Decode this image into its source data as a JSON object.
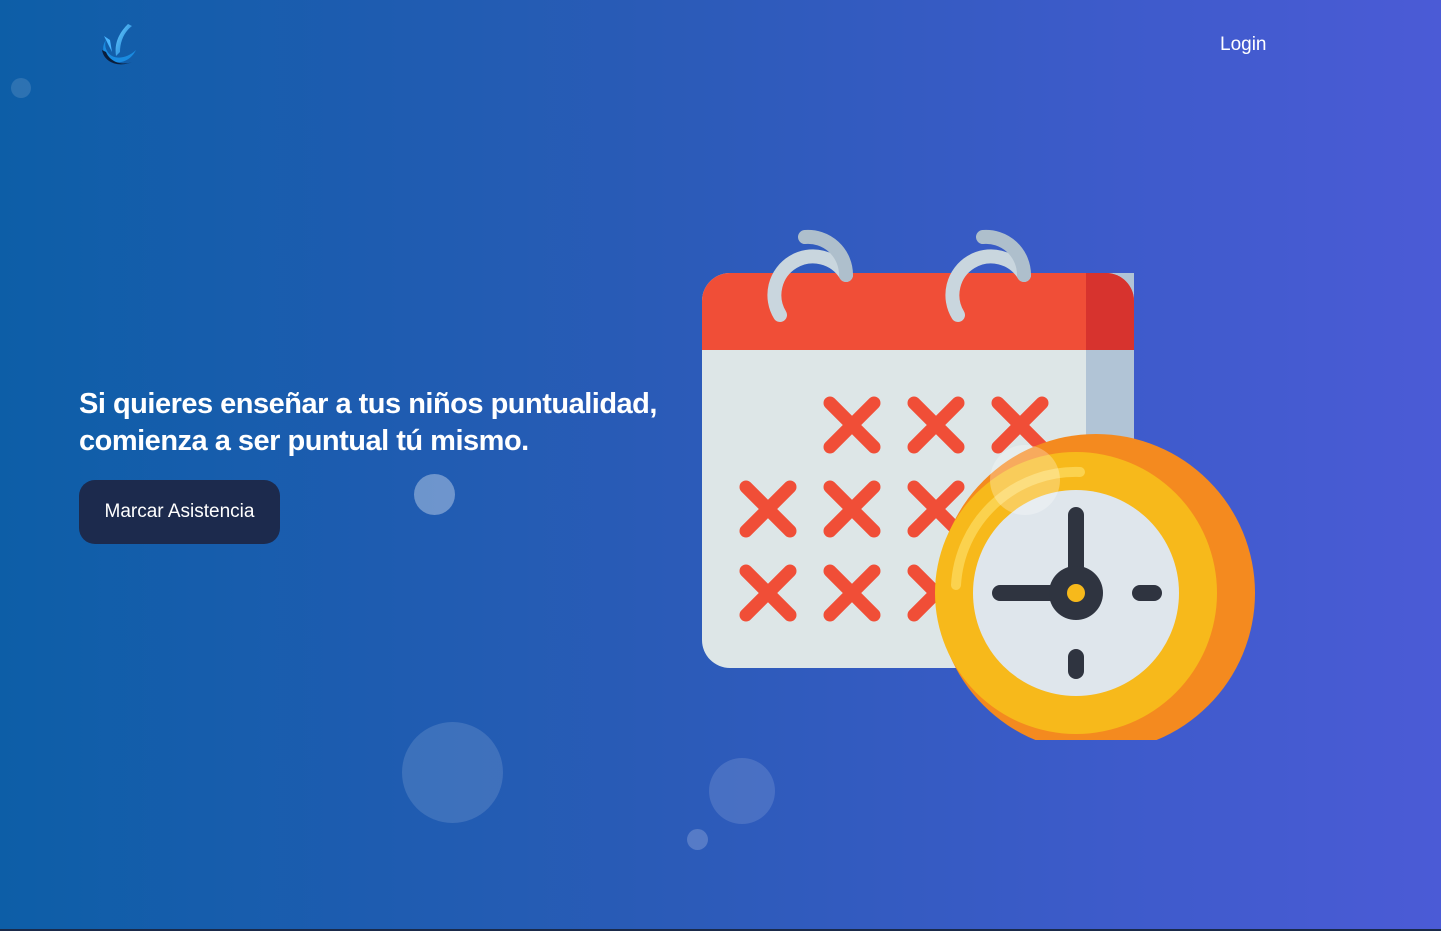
{
  "header": {
    "logo_icon": "brand-swoosh-logo",
    "login_label": "Login"
  },
  "hero": {
    "quote_line1": "Si quieres enseñar a tus niños puntualidad,",
    "quote_line2": "comienza a ser puntual tú mismo.",
    "cta_label": "Marcar Asistencia"
  },
  "illustration": {
    "icon": "calendar-clock-icon",
    "colors": {
      "calendar_header": "#f04e37",
      "calendar_body": "#dde6e7",
      "x_marks": "#f04e37",
      "clock_ring": "#f7b91b",
      "clock_shadow": "#f48a1f",
      "clock_face": "#dfe6ec",
      "clock_hands": "#2f3440"
    }
  },
  "colors": {
    "background_start": "#0d5ea7",
    "background_end": "#4b5bd6",
    "button_bg": "#1c2a4d",
    "text": "#ffffff"
  }
}
